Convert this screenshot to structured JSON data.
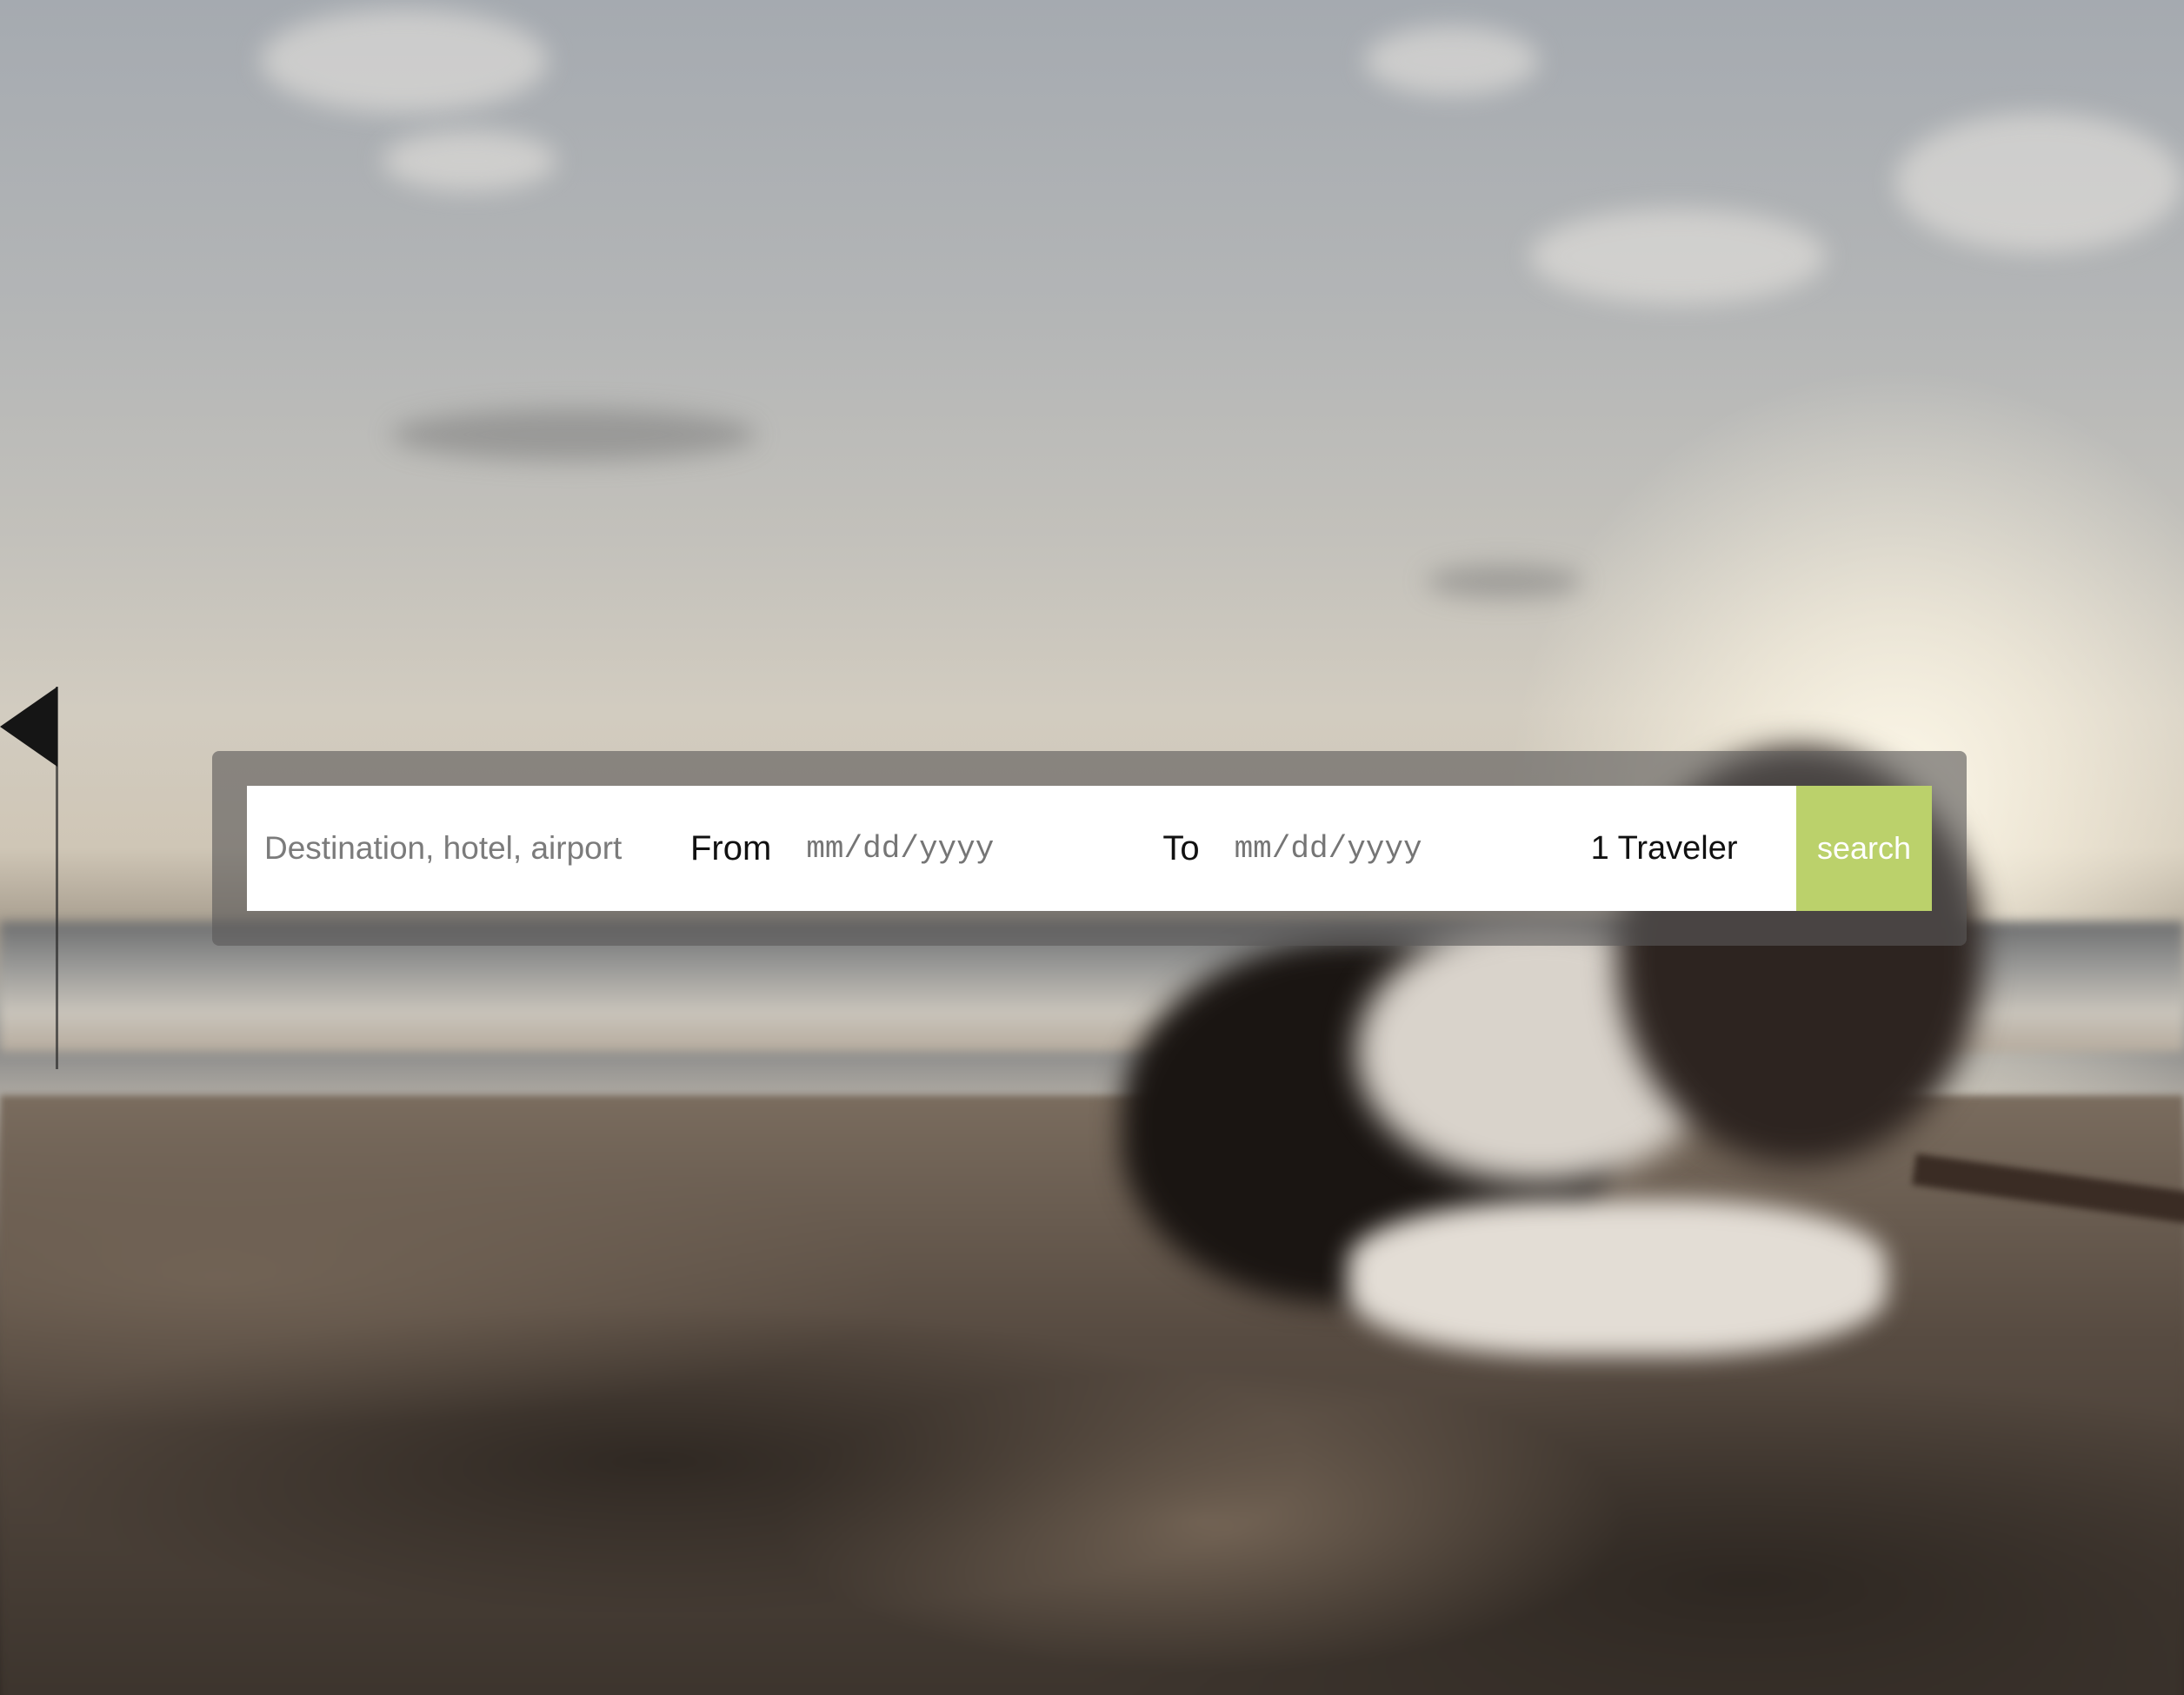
{
  "search": {
    "destination_placeholder": "Destination, hotel, airport",
    "destination_value": "",
    "from_label": "From",
    "from_placeholder": "mm/dd/yyyy",
    "to_label": "To",
    "to_placeholder": "mm/dd/yyyy",
    "travelers": "1 Traveler",
    "button_label": "search"
  },
  "colors": {
    "search_button": "#bbd16b",
    "frame_overlay": "rgba(90,88,88,0.62)"
  }
}
